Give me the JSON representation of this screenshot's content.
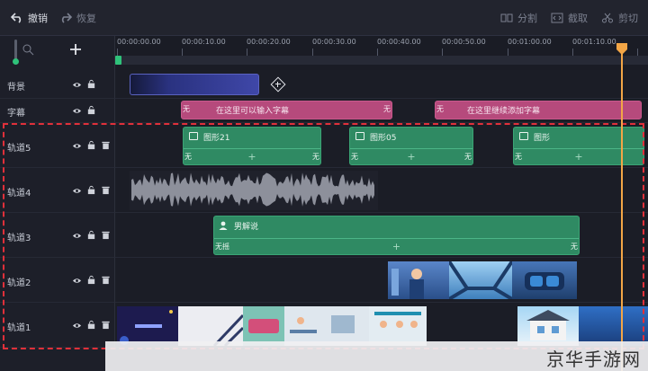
{
  "toolbar": {
    "undo_label": "撤销",
    "redo_label": "恢复",
    "split_label": "分割",
    "crop_label": "截取",
    "cut_label": "剪切"
  },
  "ruler": {
    "ticks": [
      "00:00:00.00",
      "00:00:10.00",
      "00:00:20.00",
      "00:00:30.00",
      "00:00:40.00",
      "00:00:50.00",
      "00:01:00.00",
      "00:01:10.00"
    ]
  },
  "tracks": {
    "background": {
      "label": "背景"
    },
    "subtitle": {
      "label": "字幕",
      "clip1_text": "在这里可以输入字幕",
      "clip2_text": "在这里继续添加字幕",
      "edge": "无"
    },
    "track5": {
      "label": "轨道5",
      "clip1": "图形21",
      "clip2": "图形05",
      "clip3": "图形",
      "edge": "无"
    },
    "track4": {
      "label": "轨道4"
    },
    "track3": {
      "label": "轨道3",
      "clip1": "男解说",
      "edge_left": "无摇",
      "edge_right": "无"
    },
    "track2": {
      "label": "轨道2"
    },
    "track1": {
      "label": "轨道1"
    }
  },
  "watermark": {
    "text": "京华手游网"
  },
  "colors": {
    "accent_orange": "#f3a646",
    "clip_green": "#2f8a63",
    "clip_pink": "#b64a7c",
    "clip_blue": "#3f47a8",
    "selection_red": "#e0303a"
  }
}
